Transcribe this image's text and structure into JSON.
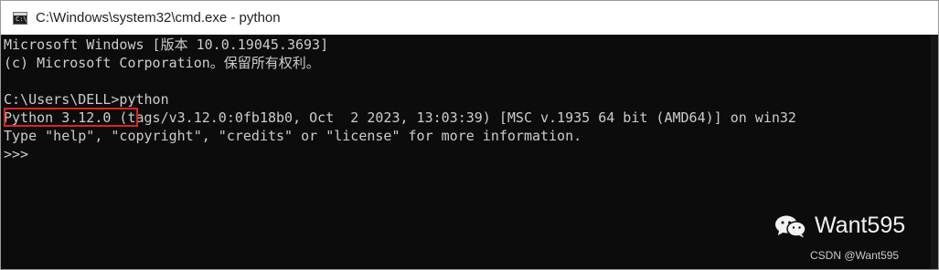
{
  "window": {
    "title": "C:\\Windows\\system32\\cmd.exe - python",
    "icon": "cmd-icon",
    "icon_glyph": "C:\\"
  },
  "console": {
    "lines": [
      "Microsoft Windows [版本 10.0.19045.3693]",
      "(c) Microsoft Corporation。保留所有权利。",
      "",
      "C:\\Users\\DELL>python",
      "Python 3.12.0 (tags/v3.12.0:0fb18b0, Oct  2 2023, 13:03:39) [MSC v.1935 64 bit (AMD64)] on win32",
      "Type \"help\", \"copyright\", \"credits\" or \"license\" for more information.",
      ">>> "
    ],
    "highlight_color": "#e02222"
  },
  "watermark": {
    "icon": "wechat-icon",
    "name": "Want595",
    "credit": "CSDN @Want595"
  }
}
